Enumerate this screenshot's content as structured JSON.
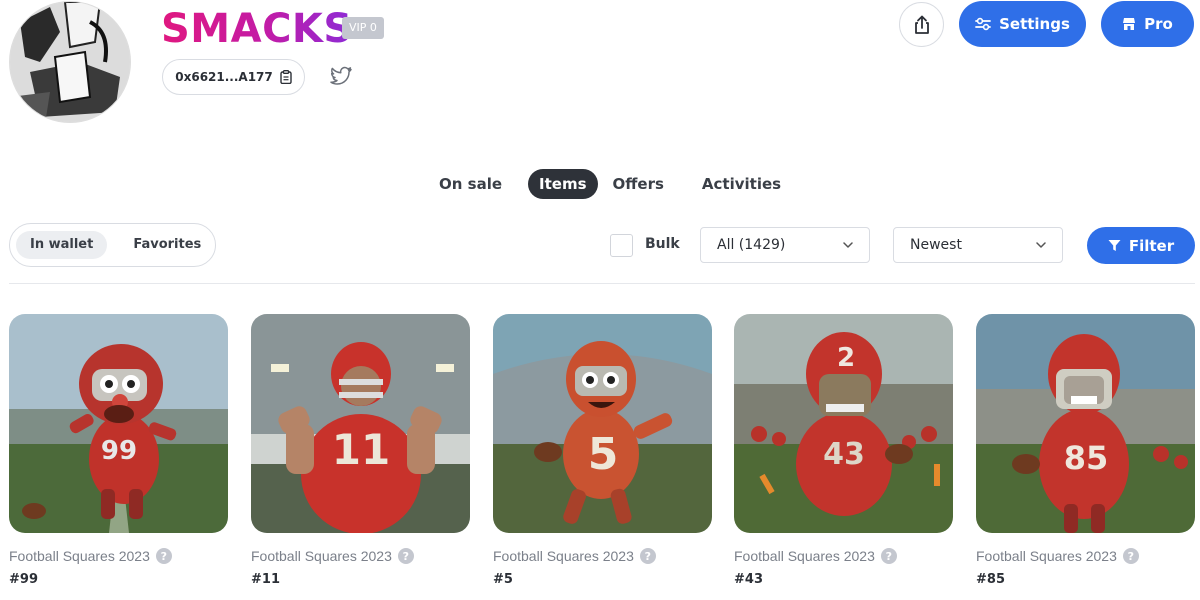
{
  "profile": {
    "name": "SMACKS",
    "vip_badge": "VIP 0",
    "address": "0x6621...A177"
  },
  "header_actions": {
    "settings_label": "Settings",
    "pro_label": "Pro"
  },
  "tabs": [
    {
      "label": "On sale",
      "active": false
    },
    {
      "label": "Items",
      "active": true
    },
    {
      "label": "Offers",
      "active": false
    },
    {
      "label": "Activities",
      "active": false
    }
  ],
  "toolbar": {
    "segment": [
      {
        "label": "In wallet",
        "active": true
      },
      {
        "label": "Favorites",
        "active": false
      }
    ],
    "bulk_label": "Bulk",
    "bulk_checked": false,
    "category_select": "All (1429)",
    "sort_select": "Newest",
    "filter_label": "Filter"
  },
  "items": [
    {
      "collection": "Football Squares 2023",
      "number": "#99"
    },
    {
      "collection": "Football Squares 2023",
      "number": "#11"
    },
    {
      "collection": "Football Squares 2023",
      "number": "#5"
    },
    {
      "collection": "Football Squares 2023",
      "number": "#43"
    },
    {
      "collection": "Football Squares 2023",
      "number": "#85"
    }
  ],
  "colors": {
    "accent": "#2f6fe8",
    "active_tab": "#2e3239",
    "name_gradient_start": "#e0187f",
    "name_gradient_end": "#8d2bd6"
  },
  "icons": [
    "avatar-image",
    "copy-icon",
    "twitter-icon",
    "share-icon",
    "sliders-icon",
    "pro-icon",
    "chevron-down-icon",
    "filter-icon",
    "help-icon"
  ]
}
